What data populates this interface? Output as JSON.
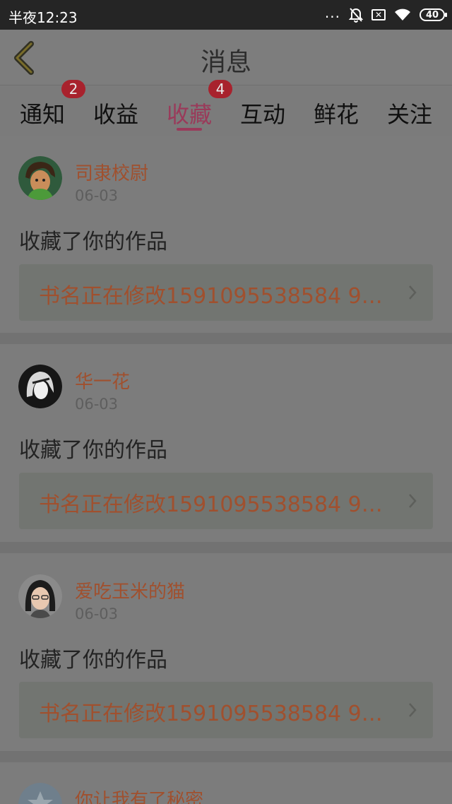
{
  "status_bar": {
    "time": "半夜12:23",
    "dots": "...",
    "sim": "✕",
    "battery": "40"
  },
  "header": {
    "title": "消息"
  },
  "tabs": [
    {
      "label": "通知",
      "badge": "2"
    },
    {
      "label": "收益"
    },
    {
      "label": "收藏",
      "badge": "4",
      "active": true
    },
    {
      "label": "互动"
    },
    {
      "label": "鲜花"
    },
    {
      "label": "关注"
    }
  ],
  "messages": [
    {
      "username": "司隶校尉",
      "date": "06-03",
      "action": "收藏了你的作品",
      "book": "书名正在修改1591095538584 9…"
    },
    {
      "username": "华一花",
      "date": "06-03",
      "action": "收藏了你的作品",
      "book": "书名正在修改1591095538584 9…"
    },
    {
      "username": "爱吃玉米的猫",
      "date": "06-03",
      "action": "收藏了你的作品",
      "book": "书名正在修改1591095538584 9…"
    },
    {
      "username": "你让我有了秘密"
    }
  ],
  "colors": {
    "accent": "#9a3a5a",
    "username": "#a0502e",
    "badge": "#a8222d"
  }
}
